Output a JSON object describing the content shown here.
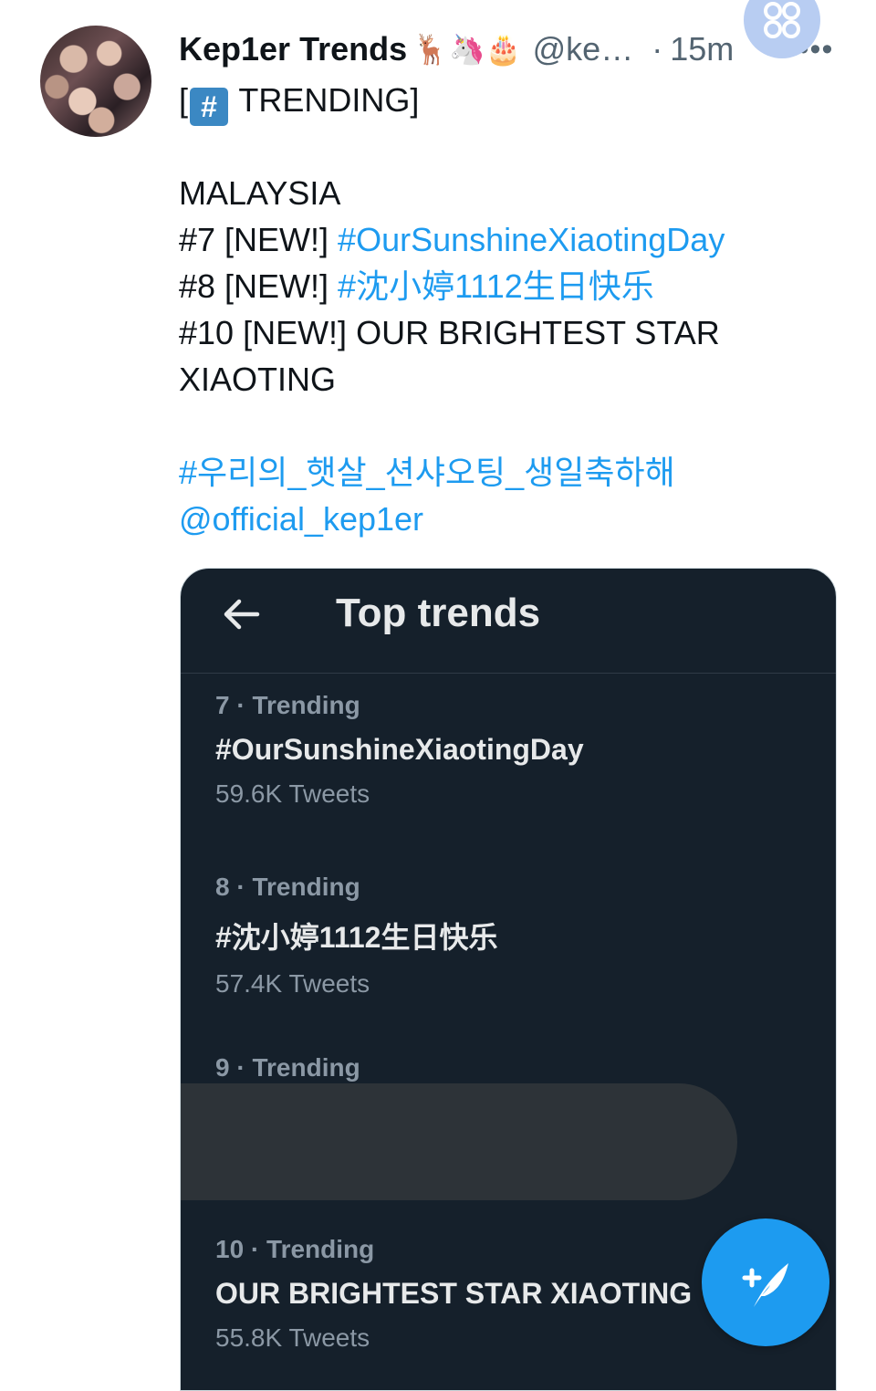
{
  "tweet": {
    "author_name": "Kep1er Trends",
    "author_emojis": "🦌🦄🎂",
    "handle": "@ke…",
    "separator": "·",
    "time": "15m",
    "more_label": "•••",
    "lines": {
      "l1_open": "[",
      "l1_hash": "#",
      "l1_close": " TRENDING]",
      "l2": "MALAYSIA",
      "l3_prefix": "#7 [NEW!] ",
      "l3_link": "#OurSunshineXiaotingDay",
      "l4_prefix": "#8 [NEW!] ",
      "l4_link": "#沈小婷1112生日快乐",
      "l5": "#10 [NEW!] OUR BRIGHTEST STAR",
      "l6": "XIAOTING",
      "l7_link": "#우리의_햇살_션샤오팅_생일축하해",
      "l8_link": "@official_kep1er"
    }
  },
  "media": {
    "title": "Top trends",
    "trends": [
      {
        "meta": "7 · Trending",
        "name": "#OurSunshineXiaotingDay",
        "count": "59.6K Tweets"
      },
      {
        "meta": "8 · Trending",
        "name": "#沈小婷1112生日快乐",
        "count": "57.4K Tweets"
      },
      {
        "meta": "9 · Trending"
      },
      {
        "meta": "10 · Trending",
        "name": "OUR BRIGHTEST STAR XIAOTING",
        "count": "55.8K Tweets"
      }
    ]
  },
  "icons": {
    "floating": "clover-icon",
    "compose": "compose-tweet-icon",
    "back": "back-arrow-icon"
  },
  "colors": {
    "link": "#1d9bf0",
    "media_bg": "#15202b",
    "fab": "#1d9bf0"
  }
}
